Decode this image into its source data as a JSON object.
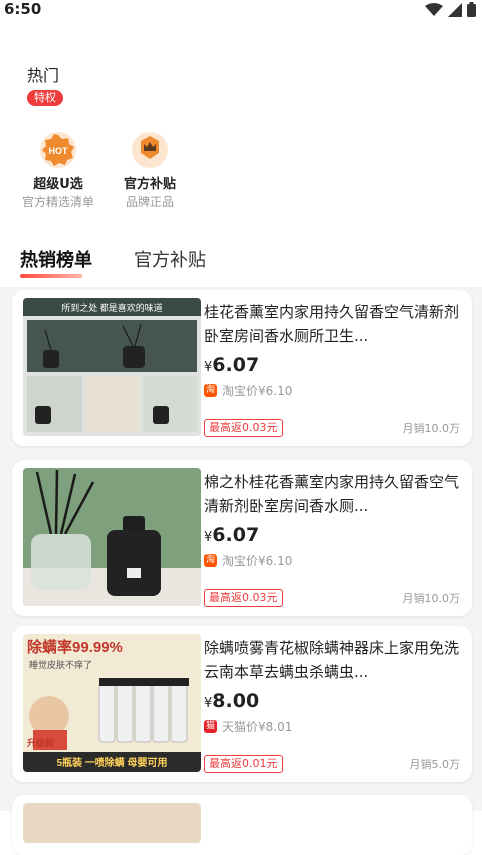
{
  "status_bar": {
    "time": "6:50"
  },
  "hot": {
    "title": "热门",
    "badge": "特权"
  },
  "features": [
    {
      "title": "超级U选",
      "subtitle": "官方精选清单",
      "icon": "hot-badge-icon",
      "icon_text": "HOT"
    },
    {
      "title": "官方补贴",
      "subtitle": "品牌正品",
      "icon": "crown-icon"
    }
  ],
  "tabs": [
    {
      "label": "热销榜单",
      "active": true
    },
    {
      "label": "官方补贴",
      "active": false
    }
  ],
  "products": [
    {
      "title": "桂花香薰室内家用持久留香空气清新剂卧室房间香水厕所卫生...",
      "price_symbol": "¥",
      "price": "6.07",
      "platform_icon": "淘",
      "platform_price": "淘宝价¥6.10",
      "rebate": "最高返0.03元",
      "sales": "月销10.0万",
      "image_text": "所到之处 都是喜欢的味道"
    },
    {
      "title": "棉之朴桂花香薰室内家用持久留香空气清新剂卧室房间香水厕...",
      "price_symbol": "¥",
      "price": "6.07",
      "platform_icon": "淘",
      "platform_price": "淘宝价¥6.10",
      "rebate": "最高返0.03元",
      "sales": "月销10.0万"
    },
    {
      "title": "除螨喷雾青花椒除螨神器床上家用免洗云南本草去螨虫杀螨虫...",
      "price_symbol": "¥",
      "price": "8.00",
      "platform_icon": "猫",
      "platform_price": "天猫价¥8.01",
      "rebate": "最高返0.01元",
      "sales": "月销5.0万",
      "image_text": "除螨率99.99%",
      "image_sub": "睡觉皮肤不痒了",
      "image_bottom": "5瓶装  一喷除螨  母婴可用",
      "image_tag": "升级款"
    }
  ],
  "colors": {
    "accent": "#ef3b3b",
    "taobao": "#ff5500",
    "tmall": "#e4222b"
  }
}
